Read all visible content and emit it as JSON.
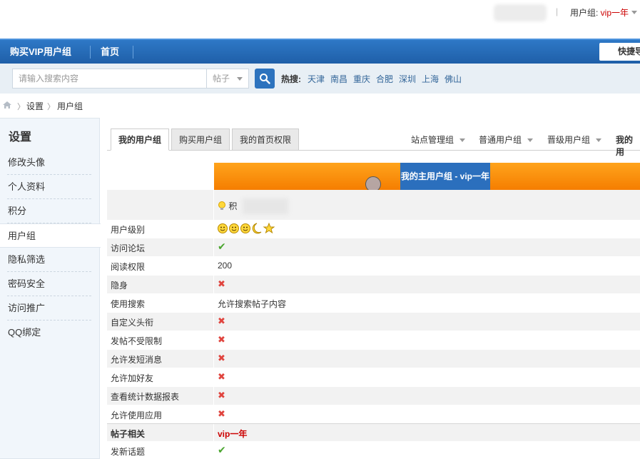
{
  "topbar": {
    "usergroup_label": "用户组: ",
    "usergroup_value": "vip一年",
    "separator": "|"
  },
  "nav": {
    "item1": "购买VIP用户组",
    "item2": "首页",
    "quick": "快捷导"
  },
  "search": {
    "placeholder": "请输入搜索内容",
    "type": "帖子",
    "hot_label": "热搜:",
    "hot": [
      "天津",
      "南昌",
      "重庆",
      "合肥",
      "深圳",
      "上海",
      "佛山"
    ]
  },
  "breadcrumb": [
    "设置",
    "用户组"
  ],
  "sidebar": {
    "title": "设置",
    "items": [
      "修改头像",
      "个人资料",
      "积分",
      "用户组",
      "隐私筛选",
      "密码安全",
      "访问推广",
      "QQ绑定"
    ],
    "active_index": 3
  },
  "tabs": {
    "main": [
      "我的用户组",
      "购买用户组",
      "我的首页权限"
    ],
    "sub": [
      "站点管理组",
      "普通用户组",
      "晋级用户组",
      "我的用"
    ]
  },
  "header": {
    "group_title": "我的主用户组 - vip一年",
    "points_label": "积"
  },
  "rows": [
    {
      "label": "用户级别",
      "value": "",
      "type": "stars"
    },
    {
      "label": "访问论坛",
      "value": "",
      "type": "check"
    },
    {
      "label": "阅读权限",
      "value": "200",
      "type": "text"
    },
    {
      "label": "隐身",
      "value": "",
      "type": "cross"
    },
    {
      "label": "使用搜索",
      "value": "允许搜索帖子内容",
      "type": "text"
    },
    {
      "label": "自定义头衔",
      "value": "",
      "type": "cross"
    },
    {
      "label": "发帖不受限制",
      "value": "",
      "type": "cross"
    },
    {
      "label": "允许发短消息",
      "value": "",
      "type": "cross"
    },
    {
      "label": "允许加好友",
      "value": "",
      "type": "cross"
    },
    {
      "label": "查看统计数据报表",
      "value": "",
      "type": "cross"
    },
    {
      "label": "允许使用应用",
      "value": "",
      "type": "cross"
    },
    {
      "label": "帖子相关",
      "value": "vip一年",
      "type": "section"
    },
    {
      "label": "发新话题",
      "value": "",
      "type": "check"
    }
  ],
  "colors": {
    "nav_blue": "#1f5fa8",
    "orange": "#f57e00",
    "check_green": "#4aa52e",
    "cross_red": "#e0443e",
    "vip_red": "#cc0000"
  }
}
